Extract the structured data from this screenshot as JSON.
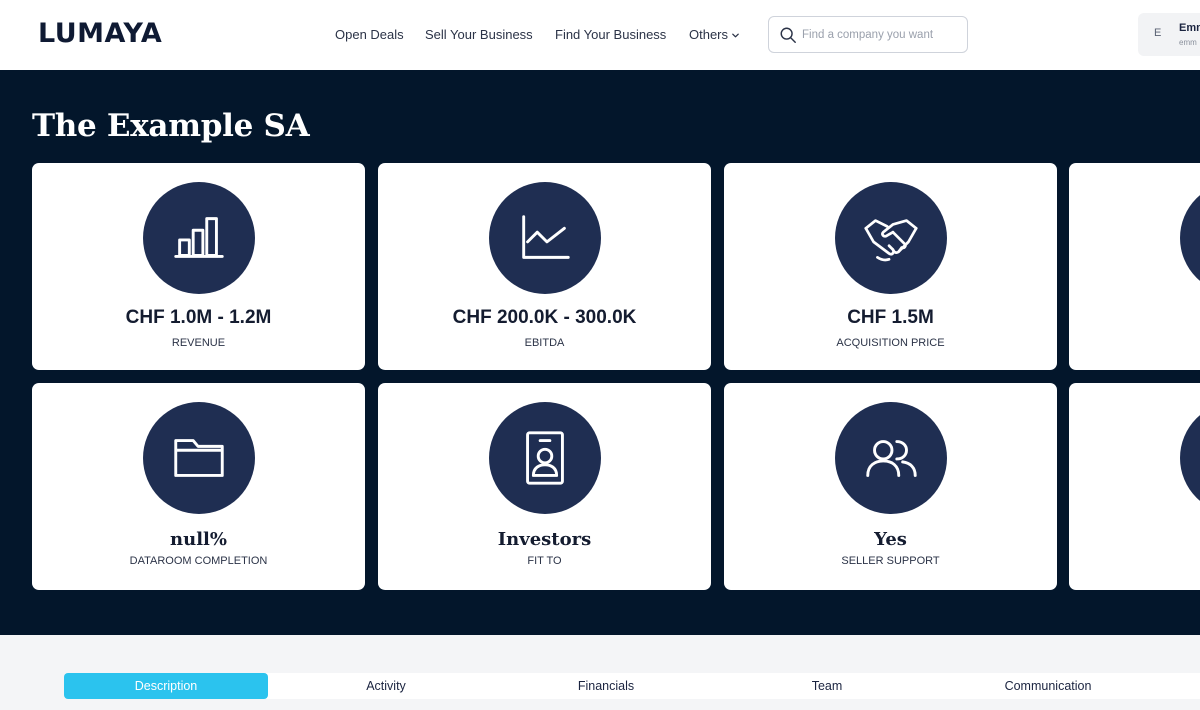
{
  "brand": {
    "logo_text": "LUMAYA"
  },
  "nav": {
    "links": [
      "Open Deals",
      "Sell Your Business",
      "Find Your Business",
      "Others"
    ]
  },
  "search": {
    "placeholder": "Find a company you want"
  },
  "user": {
    "initial": "E",
    "name": "Emm",
    "email": "emm"
  },
  "company": {
    "title": "The Example SA"
  },
  "kpis": [
    {
      "value": "CHF 1.0M - 1.2M",
      "label": "REVENUE",
      "icon": "bar-chart-icon"
    },
    {
      "value": "CHF 200.0K - 300.0K",
      "label": "EBITDA",
      "icon": "line-chart-icon"
    },
    {
      "value": "CHF 1.5M",
      "label": "ACQUISITION PRICE",
      "icon": "handshake-icon"
    },
    {
      "value": "",
      "label": "",
      "icon": "partial-icon"
    },
    {
      "value": "null%",
      "label": "DATAROOM COMPLETION",
      "icon": "folder-icon"
    },
    {
      "value": "Investors",
      "label": "FIT TO",
      "icon": "id-badge-icon"
    },
    {
      "value": "Yes",
      "label": "SELLER SUPPORT",
      "icon": "users-icon"
    },
    {
      "value": "",
      "label": "",
      "icon": "partial-icon"
    }
  ],
  "tabs": [
    {
      "label": "Description",
      "active": true
    },
    {
      "label": "Activity",
      "active": false
    },
    {
      "label": "Financials",
      "active": false
    },
    {
      "label": "Team",
      "active": false
    },
    {
      "label": "Communication",
      "active": false
    }
  ],
  "colors": {
    "hero_bg": "#03162b",
    "icon_circle": "#1f2e52",
    "active_tab": "#2bc3ee",
    "tab_area_bg": "#f4f5f7"
  }
}
